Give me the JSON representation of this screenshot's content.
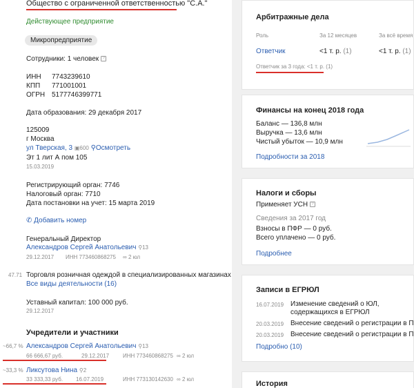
{
  "company": {
    "name": "Общество с ограниченной ответственностью \"С.А.\"",
    "status": "Действующее предприятие",
    "size_badge": "Микропредприятие",
    "employees": "Сотрудники: 1 человек",
    "inn_label": "ИНН",
    "inn": "7743239610",
    "kpp_label": "КПП",
    "kpp": "771001001",
    "ogrn_label": "ОГРН",
    "ogrn": "5177746399771",
    "founded": "Дата образования: 29 декабря 2017",
    "zip": "125009",
    "city": "г Москва",
    "street": "ул Тверская, 3",
    "street_count": "600",
    "view_link": "Осмотреть",
    "unit": "Эт 1 лит А пом 105",
    "addr_date": "15.03.2019",
    "reg_organ": "Регистрирующий орган: 7746",
    "tax_organ": "Налоговый орган: 7710",
    "tax_date": "Дата постановки на учет: 15 марта 2019",
    "add_phone": "Добавить номер",
    "director_title": "Генеральный Директор",
    "director_name": "Александров Сергей Анатольевич",
    "director_count": "13",
    "director_date": "29.12.2017",
    "director_inn": "ИНН 773460868275",
    "director_ul": "2 юл",
    "okved_code": "47.71",
    "okved_text": "Торговля розничная одеждой в специализированных магазинах",
    "all_activities": "Все виды деятельности (16)",
    "capital": "Уставный капитал: 100 000 руб.",
    "capital_date": "29.12.2017",
    "founders_title": "Учредители и участники",
    "founders": [
      {
        "share": "~66,7 %",
        "name": "Александров Сергей Анатольевич",
        "count": "13",
        "amount": "66 666,67 руб.",
        "date": "29.12.2017",
        "inn": "ИНН 773460868275",
        "ul": "2 юл"
      },
      {
        "share": "~33,3 %",
        "name": "Ликсутова Нина",
        "count": "2",
        "amount": "33 333,33 руб.",
        "date": "16.07.2019",
        "inn": "ИНН 773130142630",
        "ul": "2 юл"
      }
    ]
  },
  "arbitrage": {
    "title": "Арбитражные дела",
    "col_role": "Роль",
    "col_12m": "За 12 месяцев",
    "col_all": "За всё время",
    "row_role": "Ответчик",
    "row_12m": "<1 т. р.",
    "row_12m_count": "(1)",
    "row_all": "<1 т. р.",
    "row_all_count": "(1)",
    "note": "Ответчик за 3 года: <1 т. р. (1)"
  },
  "finance": {
    "title": "Финансы на конец 2018 года",
    "balance": "Баланс — 136,8 млн",
    "revenue": "Выручка — 13,6 млн",
    "loss": "Чистый убыток — 10,9 млн",
    "more": "Подробности за 2018"
  },
  "taxes": {
    "title": "Налоги и сборы",
    "regime": "Применяет УСН",
    "subtitle": "Сведения за 2017 год",
    "pfr": "Взносы в ПФР — 0 руб.",
    "total": "Всего уплачено — 0 руб.",
    "more": "Подробнее"
  },
  "egrul": {
    "title": "Записи в ЕГРЮЛ",
    "entries": [
      {
        "date": "16.07.2019",
        "text1": "Изменение сведений о ЮЛ,",
        "text2": "содержащихся в ЕГРЮЛ"
      },
      {
        "date": "20.03.2019",
        "text1": "Внесение сведений о регистрации в ПФР",
        "text2": ""
      },
      {
        "date": "20.03.2019",
        "text1": "Внесение сведений о регистрации в ПФР",
        "text2": ""
      }
    ],
    "more": "Подробно (10)"
  },
  "history": {
    "title": "История"
  },
  "colors": {
    "accent_red": "#d9302a",
    "link": "#2a5db0",
    "active_green": "#2e8b2e"
  }
}
